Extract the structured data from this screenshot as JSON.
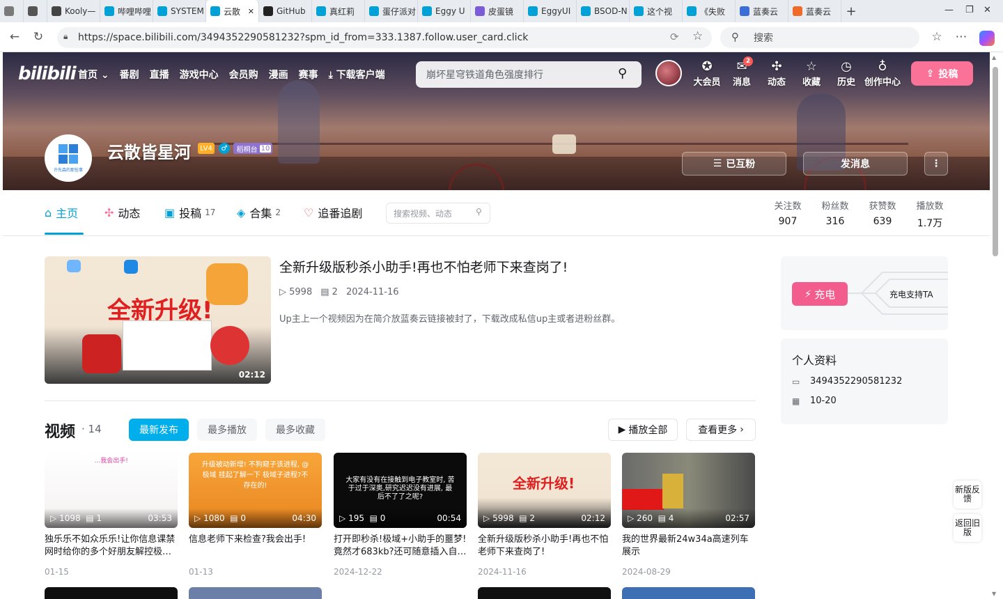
{
  "browser": {
    "tabs": [
      {
        "label": "",
        "icon": "profile-icon",
        "color": "#7a7a7a"
      },
      {
        "label": "",
        "icon": "tab-actions-icon",
        "color": "#555555"
      },
      {
        "label": "Kooly—",
        "icon": "game-icon",
        "color": "#444444"
      },
      {
        "label": "哔哩哔哩",
        "icon": "bilibili-tv-icon",
        "color": "#00a1d6"
      },
      {
        "label": "SYSTEM",
        "icon": "bilibili-tv-icon",
        "color": "#00a1d6"
      },
      {
        "label": "云散",
        "icon": "bilibili-tv-icon",
        "color": "#00a1d6",
        "active": true
      },
      {
        "label": "GitHub",
        "icon": "github-icon",
        "color": "#222222"
      },
      {
        "label": "真红莉",
        "icon": "bilibili-tv-icon",
        "color": "#00a1d6"
      },
      {
        "label": "蛋仔派对",
        "icon": "bilibili-tv-icon",
        "color": "#00a1d6"
      },
      {
        "label": "Eggy U",
        "icon": "bilibili-tv-icon",
        "color": "#00a1d6"
      },
      {
        "label": "皮蛋镜",
        "icon": "purple-app-icon",
        "color": "#7b5bd6"
      },
      {
        "label": "EggyUI",
        "icon": "bilibili-tv-icon",
        "color": "#00a1d6"
      },
      {
        "label": "BSOD-N",
        "icon": "bilibili-tv-icon",
        "color": "#00a1d6"
      },
      {
        "label": "这个视",
        "icon": "bilibili-tv-icon",
        "color": "#00a1d6"
      },
      {
        "label": "《失败",
        "icon": "bilibili-tv-icon",
        "color": "#00a1d6"
      },
      {
        "label": "蓝奏云",
        "icon": "search-icon",
        "color": "#3b6fd8"
      },
      {
        "label": "蓝奏云",
        "icon": "lanzou-icon",
        "color": "#f06a2a"
      }
    ],
    "new_tab": "+",
    "url": "https://space.bilibili.com/3494352290581232?spm_id_from=333.1387.follow.user_card.click",
    "search_placeholder": "搜索"
  },
  "topnav": {
    "logo": "bilibili",
    "links": [
      "首页",
      "番剧",
      "直播",
      "游戏中心",
      "会员购",
      "漫画",
      "赛事",
      "下载客户端"
    ],
    "search_placeholder": "崩坏星穹铁道角色强度排行",
    "right_items": [
      {
        "label": "大会员",
        "icon": "vip-icon"
      },
      {
        "label": "消息",
        "icon": "message-icon",
        "badge": "2"
      },
      {
        "label": "动态",
        "icon": "dynamic-icon"
      },
      {
        "label": "收藏",
        "icon": "favorite-icon"
      },
      {
        "label": "历史",
        "icon": "history-icon"
      },
      {
        "label": "创作中心",
        "icon": "creator-icon"
      }
    ],
    "upload": "投稿"
  },
  "profile": {
    "name": "云散皆星河",
    "level": "LV4",
    "medal_name": "稻桐台",
    "medal_level": "10",
    "avatar_caption": "许先森的那些事",
    "follow_button": "已互粉",
    "message_button": "发消息"
  },
  "tabs": [
    {
      "label": "主页",
      "count": ""
    },
    {
      "label": "动态",
      "count": ""
    },
    {
      "label": "投稿",
      "count": "17"
    },
    {
      "label": "合集",
      "count": "2"
    },
    {
      "label": "追番追剧",
      "count": ""
    }
  ],
  "space_search_placeholder": "搜索视频、动态",
  "stats": [
    {
      "label": "关注数",
      "value": "907"
    },
    {
      "label": "粉丝数",
      "value": "316"
    },
    {
      "label": "获赞数",
      "value": "639"
    },
    {
      "label": "播放数",
      "value": "1.7万"
    }
  ],
  "featured": {
    "title": "全新升级版秒杀小助手!再也不怕老师下来查岗了!",
    "plays": "5998",
    "comments": "2",
    "date": "2024-11-16",
    "desc": "Up主上一个视频因为在简介放蓝奏云链接被封了，下载改成私信up主或者进粉丝群。",
    "duration": "02:12",
    "thumb_text": "全新升级!"
  },
  "videos_section": {
    "title": "视频",
    "count": "14",
    "sorts": [
      "最新发布",
      "最多播放",
      "最多收藏"
    ],
    "play_all": "播放全部",
    "see_more": "查看更多"
  },
  "videos": [
    {
      "title": "独乐乐不如众乐乐!让你信息课禁网时给你的多个好朋友解控极…",
      "plays": "1098",
      "comments": "1",
      "duration": "03:53",
      "date": "01-15",
      "thumb_text": "…我会出手!"
    },
    {
      "title": "信息老师下来检查?我会出手!",
      "plays": "1080",
      "comments": "0",
      "duration": "04:30",
      "date": "01-13",
      "thumb_text": "升级被动新增! 不狗窥子该进程, @极域 挂起了解一下 极域子进程?不存在的!"
    },
    {
      "title": "打开即秒杀!极域+小助手的噩梦!竟然才683kb?还可随意插入自…",
      "plays": "195",
      "comments": "0",
      "duration": "00:54",
      "date": "2024-12-22",
      "thumb_text": "大家有没有在接触到电子教室时, 苦于过于深奥,研究迟迟没有进展, 最后不了了之呢?"
    },
    {
      "title": "全新升级版秒杀小助手!再也不怕老师下来查岗了!",
      "plays": "5998",
      "comments": "2",
      "duration": "02:12",
      "date": "2024-11-16",
      "thumb_text": "全新升级!"
    },
    {
      "title": "我的世界最新24w34a高速列车展示",
      "plays": "260",
      "comments": "4",
      "duration": "02:57",
      "date": "2024-08-29",
      "thumb_text": ""
    }
  ],
  "charge": {
    "button": "充电",
    "text": "充电支持TA"
  },
  "info": {
    "title": "个人资料",
    "uid": "3494352290581232",
    "birthday": "10-20"
  },
  "float_buttons": [
    "新版反馈",
    "返回旧版"
  ]
}
